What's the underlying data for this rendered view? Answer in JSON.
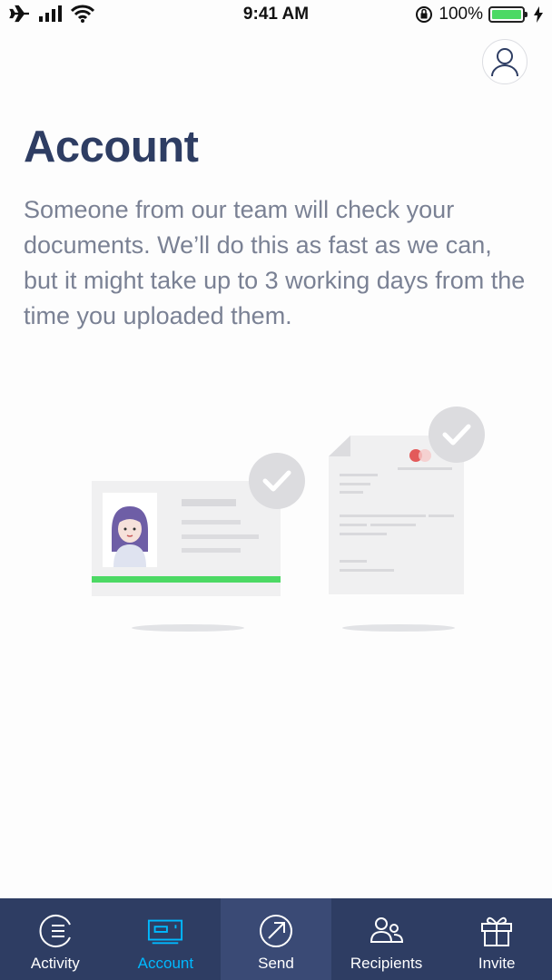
{
  "status_bar": {
    "time": "9:41 AM",
    "battery_percent": "100%",
    "icons": [
      "airplane-icon",
      "signal-icon",
      "wifi-icon",
      "rotation-lock-icon",
      "battery-icon",
      "charging-icon"
    ]
  },
  "header": {
    "profile_icon": "user-icon"
  },
  "main": {
    "title": "Account",
    "description": "Someone from our team will check your documents. We’ll do this as fast as we can, but it might take up to 3 working days from the time you uploaded them."
  },
  "illustration": {
    "id_card_icon": "id-card-icon",
    "document_icon": "document-icon",
    "check_icon": "check-icon"
  },
  "tab_bar": {
    "tabs": [
      {
        "label": "Activity",
        "icon": "activity-icon"
      },
      {
        "label": "Account",
        "icon": "account-card-icon"
      },
      {
        "label": "Send",
        "icon": "send-icon"
      },
      {
        "label": "Recipients",
        "icon": "recipients-icon"
      },
      {
        "label": "Invite",
        "icon": "gift-icon"
      }
    ],
    "selected": "Account"
  },
  "colors": {
    "primary": "#2e3d63",
    "accent": "#00b9ff",
    "text_muted": "#7a8194",
    "success": "#4cd964"
  }
}
